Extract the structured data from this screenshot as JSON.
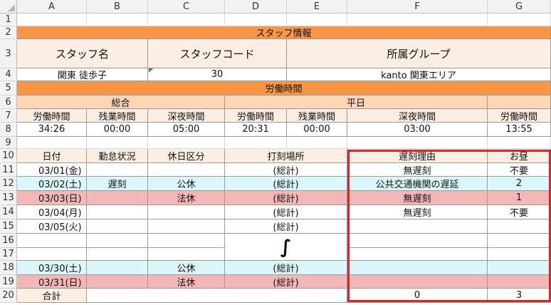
{
  "columns": [
    "A",
    "B",
    "C",
    "D",
    "E",
    "F",
    "G"
  ],
  "rows": [
    "1",
    "2",
    "3",
    "4",
    "5",
    "6",
    "7",
    "8",
    "9",
    "10",
    "11",
    "12",
    "13",
    "14",
    "15",
    "16",
    "17",
    "18",
    "19",
    "20"
  ],
  "staff_info": {
    "section_title": "スタッフ情報",
    "name_label": "スタッフ名",
    "code_label": "スタッフコード",
    "group_label": "所属グループ",
    "name_value": "関東 徒歩子",
    "code_value": "30",
    "group_value": "kanto 関東エリア"
  },
  "work_time": {
    "section_title": "労働時間",
    "total_label": "総合",
    "weekday_label": "平日",
    "headers": [
      "労働時間",
      "残業時間",
      "深夜時間",
      "労働時間",
      "残業時間",
      "深夜時間",
      "労働時間"
    ],
    "values": [
      "34:26",
      "00:00",
      "05:00",
      "20:31",
      "00:00",
      "03:00",
      "13:55"
    ]
  },
  "detail_table": {
    "headers": [
      "日付",
      "勤怠状況",
      "休日区分",
      "打刻場所",
      "遅刻理由",
      "お昼"
    ],
    "rows": [
      {
        "date": "03/01(金)",
        "status": "",
        "holiday": "",
        "place": "(総計)",
        "reason": "無遅刻",
        "lunch": "不要"
      },
      {
        "date": "03/02(土)",
        "status": "遅刻",
        "holiday": "公休",
        "place": "(総計)",
        "reason": "公共交通機関の遅延",
        "lunch": "2"
      },
      {
        "date": "03/03(日)",
        "status": "",
        "holiday": "法休",
        "place": "(総計)",
        "reason": "無遅刻",
        "lunch": "1"
      },
      {
        "date": "03/04(月)",
        "status": "",
        "holiday": "",
        "place": "(総計)",
        "reason": "無遅刻",
        "lunch": "不要"
      },
      {
        "date": "03/05(火)",
        "status": "",
        "holiday": "",
        "place": "(総計)",
        "reason": "",
        "lunch": ""
      },
      {
        "date": "03/30(土)",
        "status": "",
        "holiday": "公休",
        "place": "(総計)",
        "reason": "",
        "lunch": ""
      },
      {
        "date": "03/31(日)",
        "status": "",
        "holiday": "法休",
        "place": "(総計)",
        "reason": "",
        "lunch": ""
      }
    ],
    "ellipsis_glyph": "∫",
    "total_label": "合計",
    "total_reason": "0",
    "total_lunch": "3"
  },
  "colors": {
    "section_orange": "#f79646",
    "header_peach": "#fbd5b5",
    "saturday_cyan": "#dcf7fb",
    "sunday_pink": "#f4b7b7",
    "highlight_red": "#d9262c"
  }
}
